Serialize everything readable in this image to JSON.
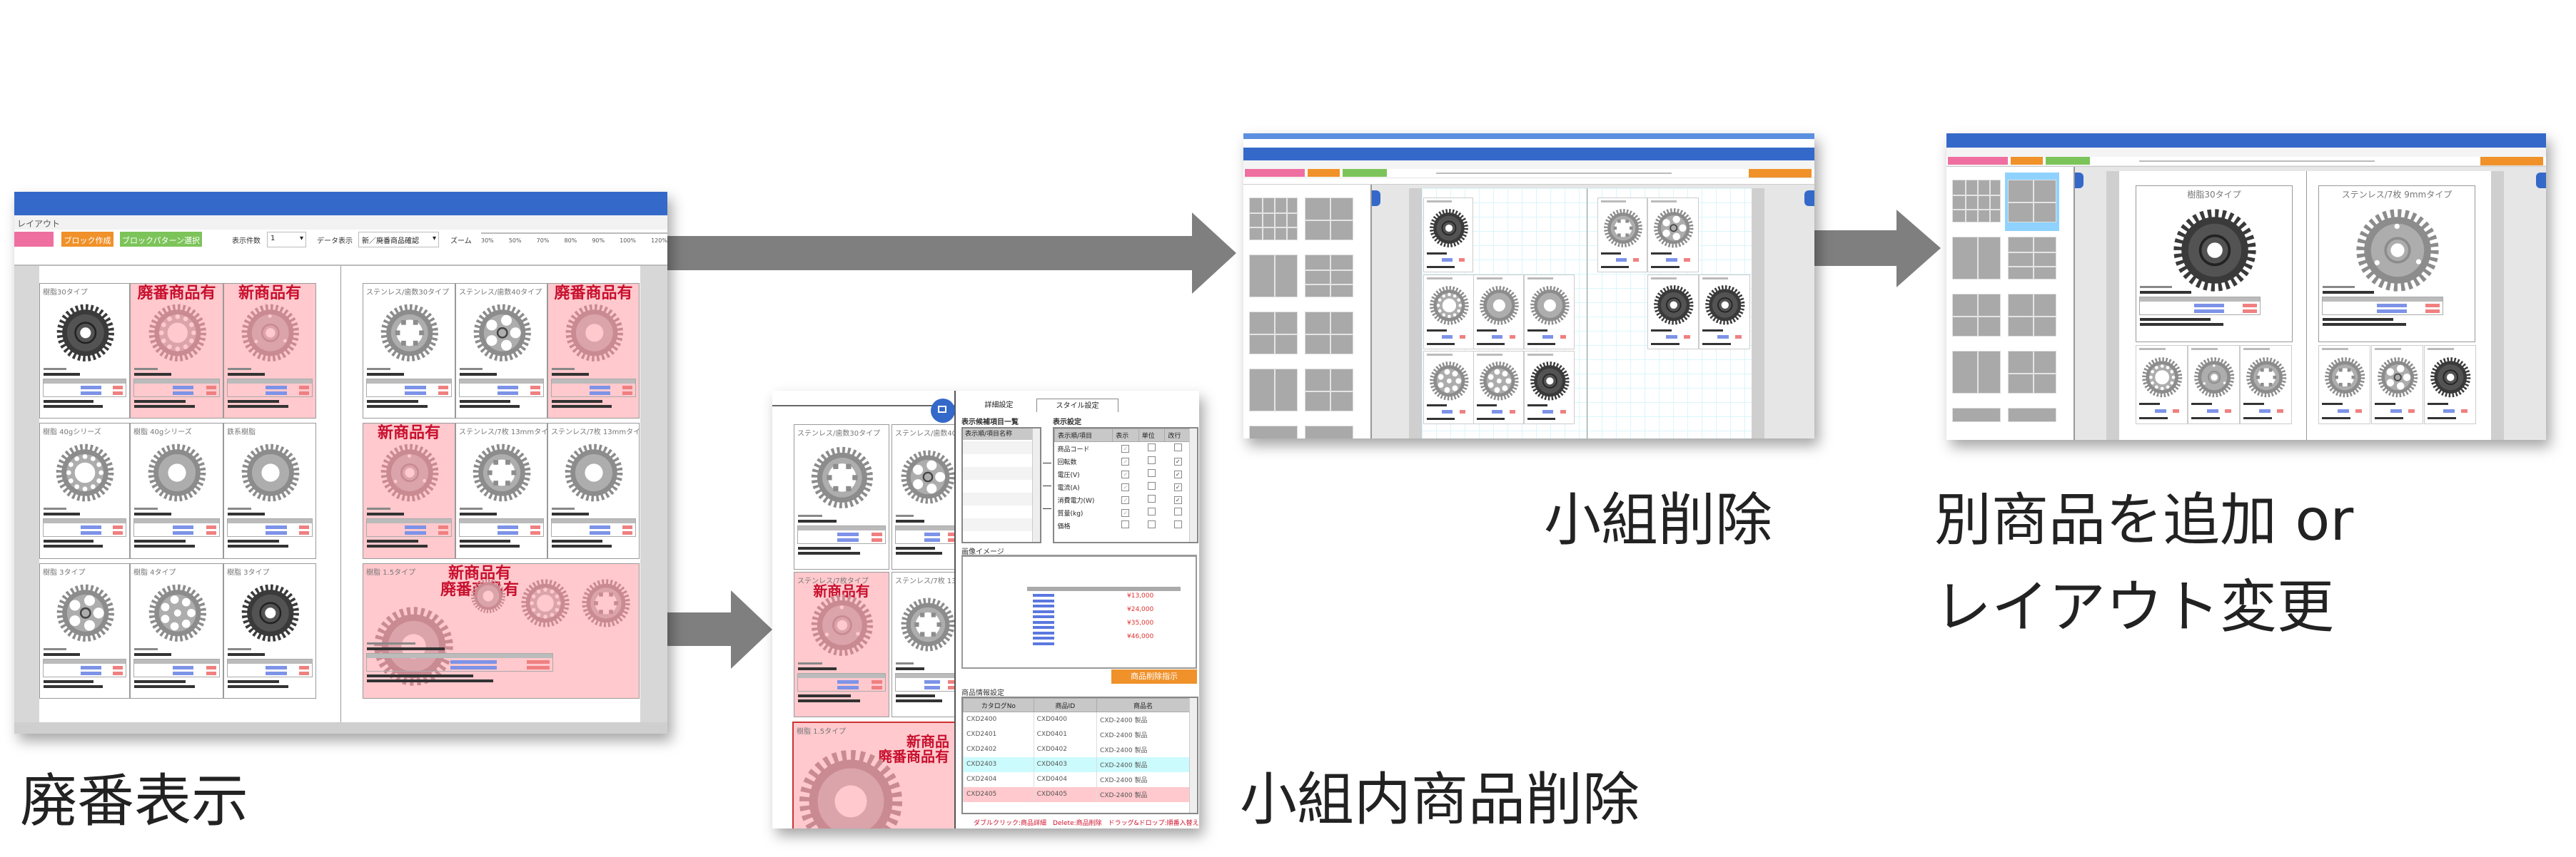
{
  "colors": {
    "arrow": "#7f7f7f",
    "header_blue": "#3469c9",
    "pink_highlight": "#ffc9cd",
    "flag_red": "#c8102e",
    "orange": "#f0912a",
    "green": "#7cc45a",
    "pink_button": "#ee6fa0",
    "cyan_row": "#ccfbfd",
    "red_row": "#ffc9cd",
    "selected_thumb": "#8fd2ff"
  },
  "steps": {
    "discontinued_display": "廃番表示",
    "delete_item_in_group": "小組内商品削除",
    "delete_group": "小組削除",
    "add_or_change_line1": "別商品を追加 or",
    "add_or_change_line2": "レイアウト変更"
  },
  "screen1": {
    "breadcrumb": "レイアウト",
    "toolbar": {
      "block_create": "ブロック作成",
      "block_pattern": "ブロックパターン選択",
      "count_label": "表示件数",
      "count_value": "1",
      "data_label": "データ表示",
      "data_value": "新／廃番商品確認",
      "zoom_label": "ズーム",
      "zoom_ticks": [
        "30%",
        "50%",
        "70%",
        "80%",
        "90%",
        "100%",
        "120%"
      ]
    },
    "flags": {
      "discontinued": "廃番商品有",
      "new": "新商品有"
    },
    "left_page": [
      {
        "title": "樹脂30タイプ",
        "flag": "",
        "pink": false,
        "icon": "gear-dark-icon"
      },
      {
        "title": "",
        "flag": "discontinued",
        "pink": true,
        "icon": "gear-ring-icon"
      },
      {
        "title": "",
        "flag": "new",
        "pink": true,
        "icon": "gear-plate-icon"
      },
      {
        "title": "樹脂 40gシリーズ",
        "flag": "",
        "pink": false,
        "icon": "gear-ring-icon"
      },
      {
        "title": "樹脂 40gシリーズ",
        "flag": "",
        "pink": false,
        "icon": "gear-plain-icon"
      },
      {
        "title": "鉄系樹脂",
        "flag": "",
        "pink": false,
        "icon": "gear-plain-icon"
      },
      {
        "title": "樹脂 3タイプ",
        "flag": "",
        "pink": false,
        "icon": "gear-spokes-icon"
      },
      {
        "title": "樹脂 4タイプ",
        "flag": "",
        "pink": false,
        "icon": "gear-holes-icon"
      },
      {
        "title": "樹脂 3タイプ",
        "flag": "",
        "pink": false,
        "icon": "gear-dark-icon"
      }
    ],
    "right_page": [
      {
        "title": "ステンレス/歯数30タイプ",
        "flag": "",
        "pink": false,
        "icon": "gear-window-icon"
      },
      {
        "title": "ステンレス/歯数40タイプ",
        "flag": "",
        "pink": false,
        "icon": "gear-spokes-icon"
      },
      {
        "title": "",
        "flag": "discontinued",
        "pink": true,
        "icon": "gear-plain-icon"
      },
      {
        "title": "",
        "flag": "new",
        "pink": true,
        "icon": "gear-plate-icon"
      },
      {
        "title": "ステンレス/7枚 13mmタイプ",
        "flag": "",
        "pink": false,
        "icon": "gear-window-icon"
      },
      {
        "title": "ステンレス/7枚 13mmタイプ",
        "flag": "",
        "pink": false,
        "icon": "gear-plain-icon"
      }
    ],
    "big_block": {
      "title": "樹脂 1.5タイプ",
      "flag_line1": "新商品有",
      "flag_line2": "廃番商品有"
    }
  },
  "screen2": {
    "cells": [
      {
        "title": "ステンレス/歯数30タイプ",
        "pink": false,
        "flag": ""
      },
      {
        "title": "ステンレス/歯数40",
        "pink": false,
        "flag": ""
      },
      {
        "title": "ステンレス/7枚タイプ",
        "pink": true,
        "flag": "新商品有"
      },
      {
        "title": "ステンレス/7枚 13",
        "pink": false,
        "flag": ""
      }
    ],
    "big_block": {
      "title": "樹脂 1.5タイプ",
      "flag_line1": "新商品",
      "flag_line2": "廃番商品有"
    },
    "tabs": [
      "詳細設定",
      "スタイル設定"
    ],
    "candidate_list_label": "表示候補項目一覧",
    "candidate_list_header": "表示順/項目名称",
    "display_settings_label": "表示設定",
    "display_table_headers": [
      "表示順/項目",
      "表示",
      "単位",
      "改行"
    ],
    "display_items": [
      {
        "name": "商品コード",
        "show": true,
        "unit": false,
        "wrap": false
      },
      {
        "name": "回転数",
        "show": true,
        "unit": false,
        "wrap": true
      },
      {
        "name": "電圧(V)",
        "show": true,
        "unit": false,
        "wrap": true
      },
      {
        "name": "電流(A)",
        "show": true,
        "unit": false,
        "wrap": true
      },
      {
        "name": "消費電力(W)",
        "show": true,
        "unit": false,
        "wrap": true
      },
      {
        "name": "質量(kg)",
        "show": true,
        "unit": false,
        "wrap": false
      },
      {
        "name": "価格",
        "show": false,
        "unit": false,
        "wrap": false
      }
    ],
    "image_label": "画像イメージ",
    "preview_prices": [
      "¥13,000",
      "¥24,000",
      "¥35,000",
      "¥46,000"
    ],
    "delete_button": "商品削除指示",
    "product_settings_label": "商品情報設定",
    "product_table_headers": [
      "カタログNo",
      "商品ID",
      "商品名"
    ],
    "product_rows": [
      {
        "catalog": "CXD2400",
        "id": "CXD0400",
        "name": "CXD-2400 製品",
        "state": "normal"
      },
      {
        "catalog": "CXD2401",
        "id": "CXD0401",
        "name": "CXD-2400 製品",
        "state": "normal"
      },
      {
        "catalog": "CXD2402",
        "id": "CXD0402",
        "name": "CXD-2400 製品",
        "state": "normal"
      },
      {
        "catalog": "CXD2403",
        "id": "CXD0403",
        "name": "CXD-2400 製品",
        "state": "selected"
      },
      {
        "catalog": "CXD2404",
        "id": "CXD0404",
        "name": "CXD-2400 製品",
        "state": "normal"
      },
      {
        "catalog": "CXD2405",
        "id": "CXD0405",
        "name": "CXD-2400 製品",
        "state": "discontinued"
      }
    ],
    "help_note": "ダブルクリック:商品詳細　Delete:商品削除　ドラッグ&ドロップ:順番入替え"
  },
  "screen3": {
    "selected_layout": null
  },
  "screen4": {
    "left_big_title": "樹脂30タイプ",
    "right_big_title": "ステンレス/7枚 9mmタイプ",
    "selected_layout": 2
  }
}
